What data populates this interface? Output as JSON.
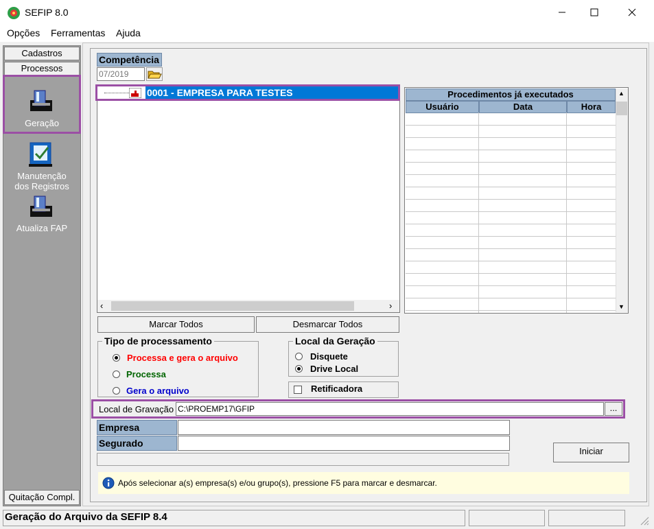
{
  "window": {
    "title": "SEFIP 8.0"
  },
  "menu": {
    "items": [
      "Opções",
      "Ferramentas",
      "Ajuda"
    ]
  },
  "sidebar": {
    "tabs": [
      "Cadastros",
      "Processos"
    ],
    "items": [
      {
        "label": "Geração"
      },
      {
        "label_line1": "Manutenção",
        "label_line2": "dos Registros"
      },
      {
        "label": "Atualiza FAP"
      }
    ],
    "bottom_tab": "Quitação Compl."
  },
  "competencia": {
    "label": "Competência",
    "value": "07/2019"
  },
  "tree": {
    "item": "0001 - EMPRESA PARA TESTES"
  },
  "procedures": {
    "title": "Procedimentos já executados",
    "columns": [
      "Usuário",
      "Data",
      "Hora"
    ]
  },
  "buttons": {
    "mark_all": "Marcar Todos",
    "unmark_all": "Desmarcar Todos",
    "browse": "...",
    "start": "Iniciar"
  },
  "tipo": {
    "title": "Tipo de processamento",
    "options": [
      {
        "label": "Processa e gera o arquivo",
        "color": "#ff0000",
        "selected": true
      },
      {
        "label": "Processa",
        "color": "#006400",
        "selected": false
      },
      {
        "label": "Gera o arquivo",
        "color": "#0000cc",
        "selected": false
      }
    ]
  },
  "local_geracao": {
    "title": "Local da Geração",
    "options": [
      {
        "label": "Disquete",
        "selected": false
      },
      {
        "label": "Drive Local",
        "selected": true
      }
    ]
  },
  "retificadora": {
    "label": "Retificadora",
    "checked": false
  },
  "gravacao": {
    "label": "Local de Gravação",
    "value": "C:\\PROEMP17\\GFIP"
  },
  "empresa": {
    "label": "Empresa",
    "value": ""
  },
  "segurado": {
    "label": "Segurado",
    "value": ""
  },
  "hint": {
    "text": "Após selecionar a(s) empresa(s) e/ou grupo(s), pressione F5 para marcar e desmarcar."
  },
  "status": {
    "text": "Geração do Arquivo da SEFIP 8.4"
  },
  "colors": {
    "highlight": "#9b4fa5",
    "header": "#9db6d0",
    "selection": "#0078d7",
    "hint_bg": "#fffde0"
  }
}
